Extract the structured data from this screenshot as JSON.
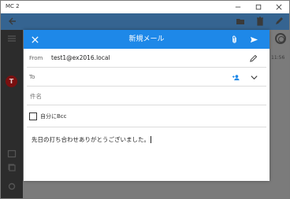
{
  "window": {
    "title": "MC 2",
    "controls": [
      "minimize-icon",
      "maximize-icon",
      "close-icon"
    ]
  },
  "background_app": {
    "avatar_initial": "T",
    "time_text": "11:56",
    "header_icons": [
      "folder-icon",
      "trash-icon",
      "pencil-icon"
    ]
  },
  "compose": {
    "title": "新規メール",
    "from_label": "From",
    "from_value": "test1@ex2016.local",
    "to_label": "To",
    "to_value": "",
    "subject_placeholder": "件名",
    "subject_value": "",
    "bcc_label": "自分にBcc",
    "bcc_checked": false,
    "body_text": "先日の打ち合わせありがとうございました。"
  },
  "colors": {
    "accent": "#1e88e8",
    "overlay": "#6b6b6b"
  }
}
